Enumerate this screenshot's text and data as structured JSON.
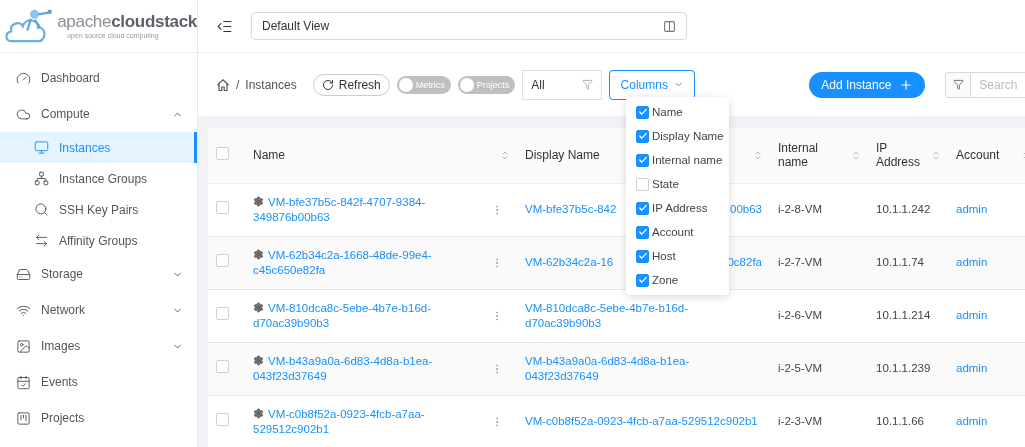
{
  "logo": {
    "name": "apache**cloudstack**",
    "tagline": "open source cloud computing"
  },
  "header": {
    "view_select": "Default View"
  },
  "sidebar": {
    "items": [
      {
        "label": "Dashboard",
        "selected": false
      },
      {
        "label": "Compute",
        "selected": false,
        "expanded": true,
        "children": [
          {
            "label": "Instances",
            "selected": true
          },
          {
            "label": "Instance Groups",
            "selected": false
          },
          {
            "label": "SSH Key Pairs",
            "selected": false
          },
          {
            "label": "Affinity Groups",
            "selected": false
          }
        ]
      },
      {
        "label": "Storage",
        "selected": false,
        "expanded": false
      },
      {
        "label": "Network",
        "selected": false,
        "expanded": false
      },
      {
        "label": "Images",
        "selected": false,
        "expanded": false
      },
      {
        "label": "Events",
        "selected": false
      },
      {
        "label": "Projects",
        "selected": false
      }
    ]
  },
  "breadcrumb": {
    "separator": "/",
    "current": "Instances"
  },
  "toolbar": {
    "refresh": "Refresh",
    "toggles": [
      {
        "label": "Metrics",
        "on": false
      },
      {
        "label": "Projects",
        "on": false
      }
    ],
    "filter": "All",
    "columns_button": "Columns",
    "add_button": "Add Instance",
    "search": {
      "placeholder": "Search"
    }
  },
  "columns_menu": [
    {
      "label": "Name",
      "checked": true
    },
    {
      "label": "Display Name",
      "checked": true
    },
    {
      "label": "Internal name",
      "checked": true
    },
    {
      "label": "State",
      "checked": false
    },
    {
      "label": "IP Address",
      "checked": true
    },
    {
      "label": "Account",
      "checked": true
    },
    {
      "label": "Host",
      "checked": true
    },
    {
      "label": "Zone",
      "checked": true
    }
  ],
  "table": {
    "header_checked": false,
    "columns": [
      "Name",
      "Display Name",
      "Internal name",
      "IP Address",
      "Account"
    ],
    "rows": [
      {
        "checked": false,
        "name": "VM-bfe37b5c-842f-4707-9384-349876b00b63",
        "display_name": [
          "VM-bfe37b5c-842",
          "00b63"
        ],
        "internal_name": "i-2-8-VM",
        "ip": "10.1.1.242",
        "account": "admin"
      },
      {
        "checked": false,
        "name": "VM-62b34c2a-1668-48de-99e4-c45c650e82fa",
        "display_name": [
          "VM-62b34c2a-16",
          "0c82fa"
        ],
        "internal_name": "i-2-7-VM",
        "ip": "10.1.1.74",
        "account": "admin"
      },
      {
        "checked": false,
        "name": "VM-810dca8c-5ebe-4b7e-b16d-d70ac39b90b3",
        "display_name": [
          "VM-810dca8c-5ebe-4b7e-b16d-d70ac39b90b3"
        ],
        "internal_name": "i-2-6-VM",
        "ip": "10.1.1.214",
        "account": "admin"
      },
      {
        "checked": false,
        "name": "VM-b43a9a0a-6d83-4d8a-b1ea-043f23d37649",
        "display_name": [
          "VM-b43a9a0a-6d83-4d8a-b1ea-043f23d37649"
        ],
        "internal_name": "i-2-5-VM",
        "ip": "10.1.1.239",
        "account": "admin"
      },
      {
        "checked": false,
        "name": "VM-c0b8f52a-0923-4fcb-a7aa-529512c902b1",
        "display_name": [
          "VM-c0b8f52a-0923-4fcb-a7aa-529512c902b1"
        ],
        "internal_name": "i-2-3-VM",
        "ip": "10.1.1.66",
        "account": "admin"
      }
    ]
  }
}
